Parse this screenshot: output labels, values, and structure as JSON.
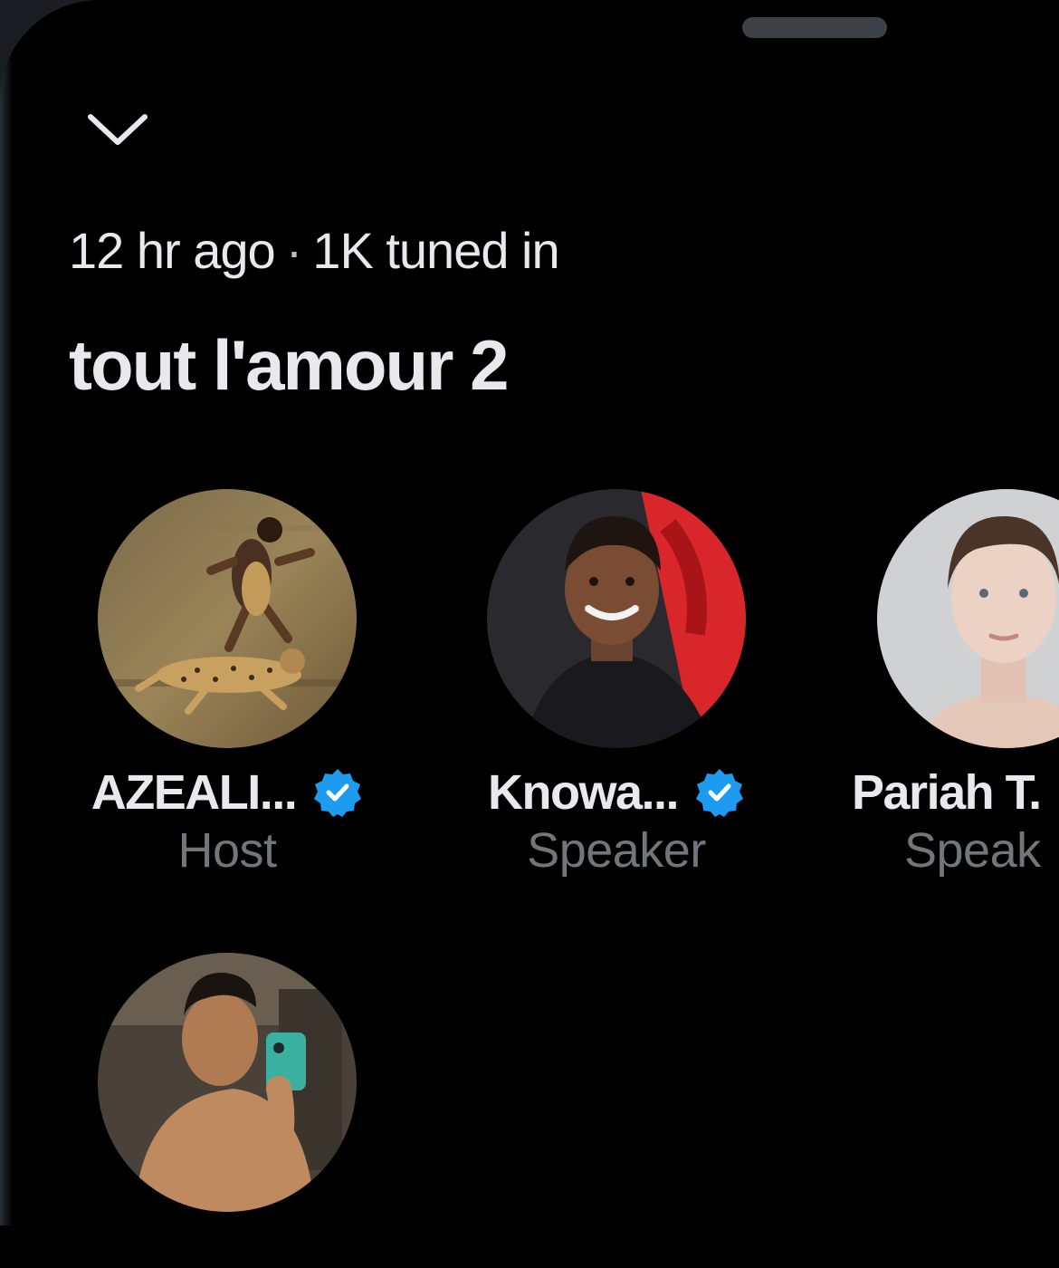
{
  "header": {
    "collapse_icon": "chevron-down-icon"
  },
  "space": {
    "meta_time": "12 hr ago",
    "meta_separator": "·",
    "meta_listeners": "1K tuned in",
    "title": "tout l'amour 2"
  },
  "participants": [
    {
      "name": "AZEALI...",
      "role": "Host",
      "verified": true
    },
    {
      "name": "Knowa...",
      "role": "Speaker",
      "verified": true
    },
    {
      "name": "Pariah T.",
      "role": "Speak",
      "verified": false
    },
    {
      "name": "",
      "role": "",
      "verified": false
    }
  ],
  "colors": {
    "background": "#000000",
    "text_primary": "#e7e9ea",
    "text_secondary": "#71767b",
    "verified_blue": "#1d9bf0"
  }
}
